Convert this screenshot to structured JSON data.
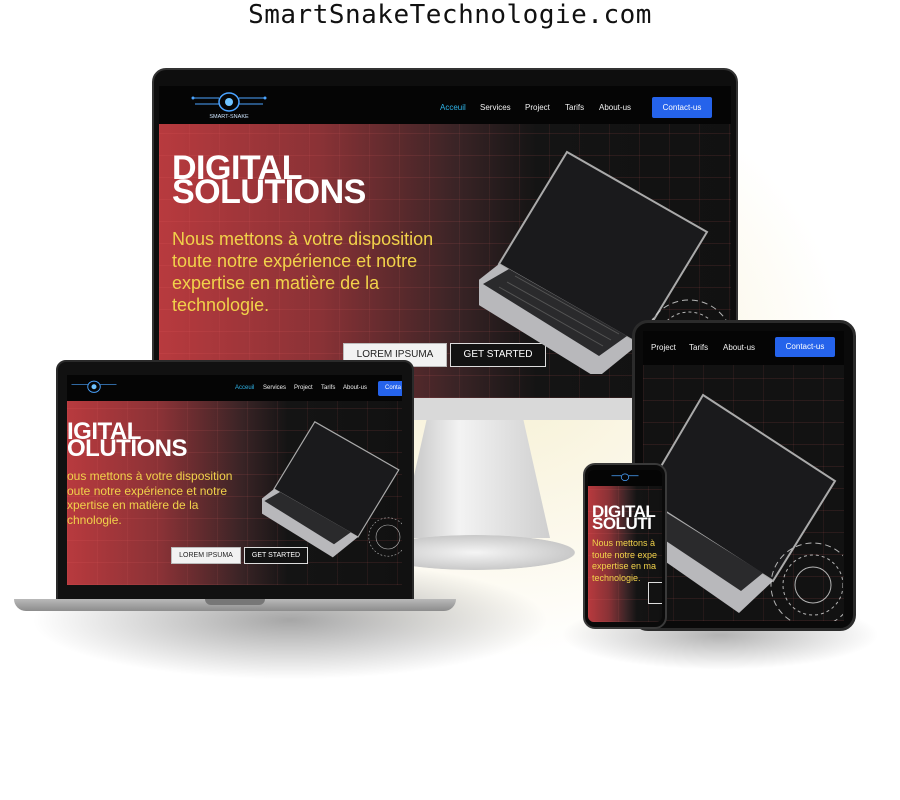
{
  "title": "SmartSnakeTechnologie.com",
  "brand": {
    "logo_text": "SMART-SNAKE"
  },
  "nav": {
    "items": [
      "Acceuil",
      "Services",
      "Project",
      "Tarifs",
      "About-us"
    ],
    "contact": "Contact-us",
    "contact_truncated": "Conta"
  },
  "hero": {
    "title_line1": "DIGITAL",
    "title_line2": "SOLUTIONS",
    "subtitle": "Nous mettons à votre disposition toute notre expérience et notre expertise en matière de la technologie.",
    "btn_lorem": "LOREM IPSUMA",
    "btn_started": "GET STARTED"
  },
  "laptop_view": {
    "title_line1": "IGITAL",
    "title_line2": "OLUTIONS",
    "sub_lines": [
      "ous mettons à votre disposition",
      "oute notre expérience et notre",
      "xpertise en matière de la",
      "chnologie."
    ]
  },
  "phone_view": {
    "title_line1": "DIGITAL",
    "title_line2": "SOLUTI",
    "sub_lines": [
      "Nous mettons à",
      "toute notre expe",
      "expertise en ma",
      "technologie."
    ]
  },
  "colors": {
    "accent_blue": "#2563eb",
    "active_link": "#2fb4e8",
    "subtitle_yellow": "#f1d24a",
    "hero_red": "#b83a3e"
  }
}
